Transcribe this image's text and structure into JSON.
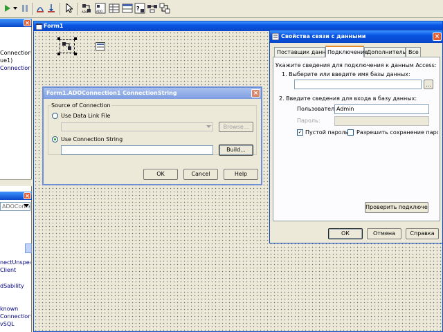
{
  "toolbar": {
    "icons": [
      "run-icon",
      "run-dropdown-icon",
      "pause-icon",
      "step-over-icon",
      "trace-into-icon",
      "pointer-icon",
      "ado-connection-icon",
      "ado-command-icon",
      "ado-dataset-icon",
      "ado-table-icon",
      "ado-query-icon",
      "ado-stored-proc-icon",
      "rds-connection-icon"
    ]
  },
  "left_panel": {
    "lines_top": [
      "Connection{",
      "ue1)",
      "Connection1"
    ],
    "object_combo": "ADOConnect",
    "lines_bottom": [
      "nectUnspec",
      "Client",
      "dSability",
      "known",
      "Connection1",
      "vSQL"
    ]
  },
  "form_designer": {
    "title": "Form1"
  },
  "connstr_dialog": {
    "title": "Form1.ADOConnection1 ConnectionString",
    "group_label": "Source of Connection",
    "option_datalink": "Use Data Link File",
    "option_connstring": "Use Connection String",
    "datalink_value": "",
    "connstring_value": "",
    "browse_button": "Browse...",
    "build_button": "Build...",
    "ok_button": "OK",
    "cancel_button": "Cancel",
    "help_button": "Help"
  },
  "datalink_dialog": {
    "title": "Свойства связи с данными",
    "tabs": [
      "Поставщик данных",
      "Подключение",
      "Дополнительно",
      "Все"
    ],
    "active_tab": 1,
    "instruction": "Укажите сведения для подключения к данным Access:",
    "step1": "1. Выберите или введите имя базы данных:",
    "db_name_value": "",
    "browse_button": "...",
    "step2": "2. Введите сведения для входа в базу данных:",
    "user_label": "Пользователь:",
    "user_value": "Admin",
    "password_label": "Пароль:",
    "password_value": "",
    "blank_password_label": "Пустой пароль",
    "blank_password_checked": true,
    "save_password_label": "Разрешить сохранение пароля",
    "save_password_checked": false,
    "test_button": "Проверить подключение",
    "ok_button": "ОК",
    "cancel_button": "Отмена",
    "help_button": "Справка"
  }
}
